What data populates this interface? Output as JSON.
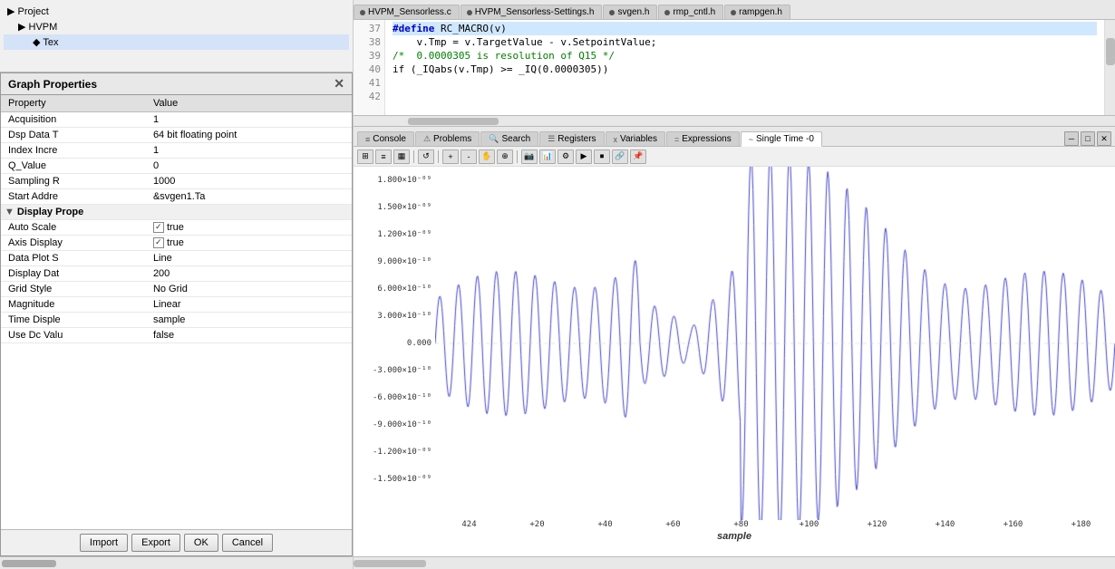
{
  "left": {
    "project_tree": {
      "items": [
        {
          "label": "Project",
          "level": 0
        },
        {
          "label": "HVPM",
          "level": 1
        },
        {
          "label": "Tex",
          "level": 2,
          "selected": true
        }
      ]
    },
    "graph_props": {
      "title": "Graph Properties",
      "columns": [
        "Property",
        "Value"
      ],
      "rows": [
        {
          "type": "prop",
          "name": "Acquisition",
          "value": "1"
        },
        {
          "type": "prop",
          "name": "Dsp Data T",
          "value": "64 bit floating point"
        },
        {
          "type": "prop",
          "name": "Index Incre",
          "value": "1"
        },
        {
          "type": "prop",
          "name": "Q_Value",
          "value": "0"
        },
        {
          "type": "prop",
          "name": "Sampling R",
          "value": "1000"
        },
        {
          "type": "prop",
          "name": "Start Addre",
          "value": "&svgen1.Ta"
        },
        {
          "type": "section",
          "name": "Display Prope",
          "value": ""
        },
        {
          "type": "prop",
          "name": "Auto Scale",
          "value": "true",
          "checkbox": true,
          "checked": true
        },
        {
          "type": "prop",
          "name": "Axis Display",
          "value": "true",
          "checkbox": true,
          "checked": true
        },
        {
          "type": "prop",
          "name": "Data Plot S",
          "value": "Line"
        },
        {
          "type": "prop",
          "name": "Display Dat",
          "value": "200"
        },
        {
          "type": "prop",
          "name": "Grid Style",
          "value": "No Grid"
        },
        {
          "type": "prop",
          "name": "Magnitude",
          "value": "Linear"
        },
        {
          "type": "prop",
          "name": "Time Disple",
          "value": "sample"
        },
        {
          "type": "prop",
          "name": "Use Dc Valu",
          "value": "false"
        }
      ],
      "buttons": [
        "Import",
        "Export",
        "OK",
        "Cancel"
      ]
    }
  },
  "right": {
    "code_tabs": [
      {
        "label": "HVPM_Sensorless.c",
        "active": false,
        "icon": "dot"
      },
      {
        "label": "HVPM_Sensorless-Settings.h",
        "active": false,
        "icon": "dot"
      },
      {
        "label": "svgen.h",
        "active": false,
        "icon": "dot"
      },
      {
        "label": "rmp_cntl.h",
        "active": false,
        "icon": "dot"
      },
      {
        "label": "rampgen.h",
        "active": false,
        "icon": "dot"
      }
    ],
    "code_lines": [
      {
        "num": "37",
        "text": "",
        "highlight": false
      },
      {
        "num": "38",
        "text": "",
        "highlight": false
      },
      {
        "num": "39",
        "text": "#define RC_MACRO(v)",
        "highlight": true,
        "has_keyword": true
      },
      {
        "num": "40",
        "text": "    v.Tmp = v.TargetValue - v.SetpointValue;",
        "highlight": false
      },
      {
        "num": "41",
        "text": "/*  0.0000305 is resolution of Q15 */",
        "highlight": false,
        "is_comment": true
      },
      {
        "num": "42",
        "text": "if (_IQabs(v.Tmp) >= _IQ(0.0000305))",
        "highlight": false
      }
    ],
    "bottom_tabs": [
      {
        "label": "Console",
        "icon": "≡",
        "active": false
      },
      {
        "label": "Problems",
        "icon": "⚠",
        "active": false
      },
      {
        "label": "Search",
        "icon": "🔍",
        "active": false
      },
      {
        "label": "Registers",
        "icon": "☰",
        "active": false
      },
      {
        "label": "Variables",
        "icon": "x",
        "active": false
      },
      {
        "label": "Expressions",
        "icon": "=",
        "active": false
      },
      {
        "label": "Single Time -0",
        "icon": "~",
        "active": true
      }
    ],
    "chart": {
      "y_labels": [
        "1.800×10⁻⁰⁹",
        "1.500×10⁻⁰⁹",
        "1.200×10⁻⁰⁹",
        "9.000×10⁻¹⁰",
        "6.000×10⁻¹⁰",
        "3.000×10⁻¹⁰",
        "0.000",
        "-3.000×10⁻¹⁰",
        "-6.000×10⁻¹⁰",
        "-9.000×10⁻¹⁰",
        "-1.200×10⁻⁰⁹",
        "-1.500×10⁻⁰⁹"
      ],
      "x_labels": [
        "424",
        "+20",
        "+40",
        "+60",
        "+80",
        "+100",
        "+120",
        "+140",
        "+160",
        "+180"
      ],
      "x_axis_label": "sample",
      "line_color": "#4444cc"
    }
  }
}
